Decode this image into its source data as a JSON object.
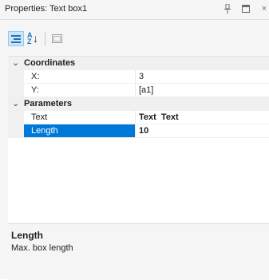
{
  "window": {
    "title": "Properties: Text box1"
  },
  "titlebar_icons": [
    "pin-icon",
    "maximize-icon",
    "close-icon"
  ],
  "toolbar": {
    "buttons": [
      "categorized-icon",
      "alphabetical-icon",
      "property-pages-icon"
    ],
    "active": "categorized-icon"
  },
  "grid": {
    "categories": [
      {
        "label": "Coordinates",
        "expanded": true,
        "properties": [
          {
            "name": "X:",
            "value": "3",
            "bold": false
          },
          {
            "name": "Y:",
            "value": "[a1]",
            "bold": false
          }
        ]
      },
      {
        "label": "Parameters",
        "expanded": true,
        "properties": [
          {
            "name": "Text",
            "value": "Text  Text",
            "bold": true
          },
          {
            "name": "Length",
            "value": "10",
            "bold": true,
            "selected": true
          }
        ]
      }
    ]
  },
  "description": {
    "title": "Length",
    "text": "Max. box length"
  },
  "colors": {
    "selection": "#0078d7",
    "category_bg": "#f0f0f0",
    "panel_bg": "#f5f5f5",
    "accent": "#1e73be"
  }
}
